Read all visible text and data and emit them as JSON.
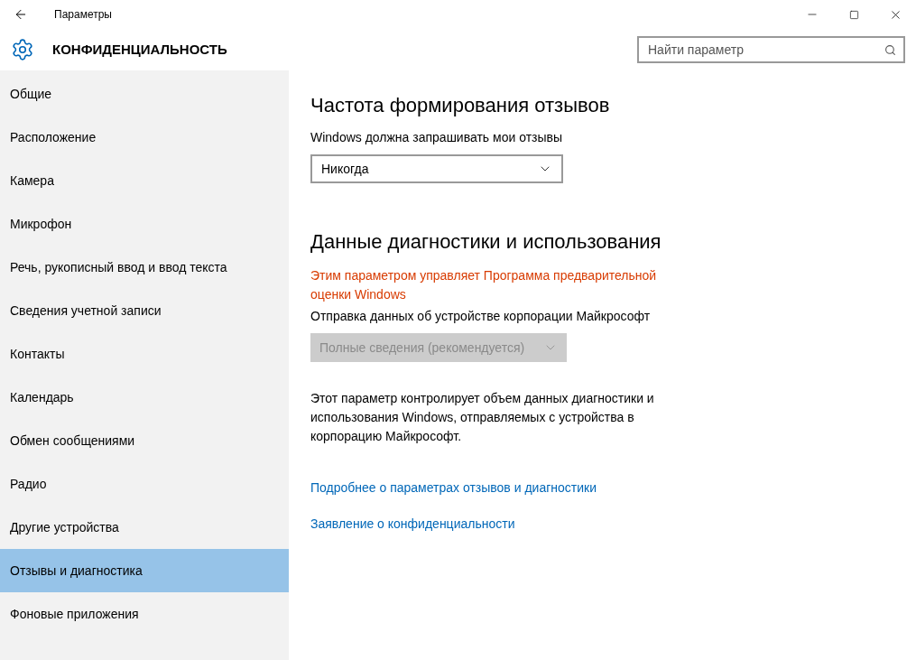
{
  "window": {
    "title": "Параметры"
  },
  "header": {
    "title": "КОНФИДЕНЦИАЛЬНОСТЬ",
    "search": {
      "placeholder": "Найти параметр"
    }
  },
  "sidebar": {
    "items": [
      {
        "label": "Общие",
        "selected": false
      },
      {
        "label": "Расположение",
        "selected": false
      },
      {
        "label": "Камера",
        "selected": false
      },
      {
        "label": "Микрофон",
        "selected": false
      },
      {
        "label": "Речь, рукописный ввод и ввод текста",
        "selected": false
      },
      {
        "label": "Сведения учетной записи",
        "selected": false
      },
      {
        "label": "Контакты",
        "selected": false
      },
      {
        "label": "Календарь",
        "selected": false
      },
      {
        "label": "Обмен сообщениями",
        "selected": false
      },
      {
        "label": "Радио",
        "selected": false
      },
      {
        "label": "Другие устройства",
        "selected": false
      },
      {
        "label": "Отзывы и диагностика",
        "selected": true
      },
      {
        "label": "Фоновые приложения",
        "selected": false
      }
    ]
  },
  "sections": [
    {
      "heading": "Частота формирования отзывов",
      "label": "Windows должна запрашивать мои отзывы",
      "dropdown": {
        "value": "Никогда",
        "disabled": false
      }
    },
    {
      "heading": "Данные диагностики и использования",
      "warning": "Этим параметром управляет Программа предварительной оценки Windows",
      "label": "Отправка данных об устройстве корпорации Майкрософт",
      "dropdown": {
        "value": "Полные сведения (рекомендуется)",
        "disabled": true
      },
      "description": "Этот параметр контролирует объем данных диагностики и использования Windows, отправляемых с устройства в корпорацию Майкрософт."
    }
  ],
  "links": [
    "Подробнее о параметрах отзывов и диагностики",
    "Заявление о конфиденциальности"
  ]
}
